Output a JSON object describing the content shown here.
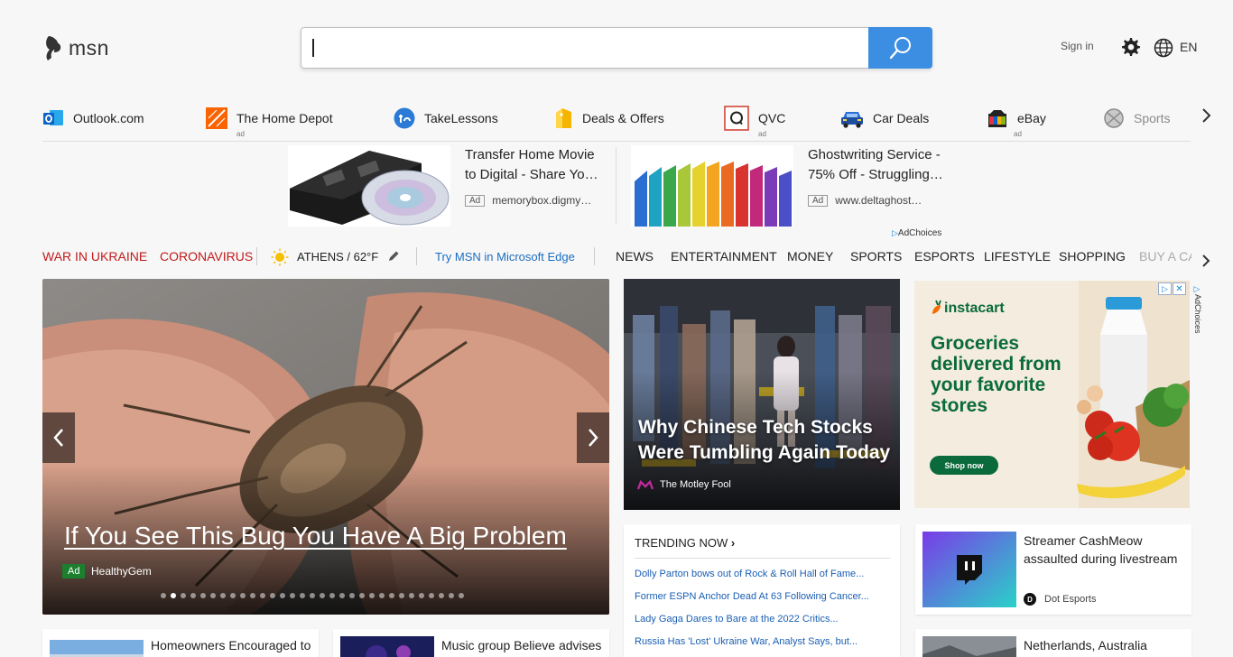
{
  "header": {
    "logo_text": "msn",
    "search": {
      "value": "",
      "placeholder": ""
    },
    "sign_in": "Sign in",
    "language": "EN"
  },
  "quick_links": [
    {
      "label": "Outlook.com",
      "ad": "",
      "icon": "outlook-icon",
      "color": "#0a64c8"
    },
    {
      "label": "The Home Depot",
      "ad": "ad",
      "icon": "home-depot-icon",
      "color": "#f96302"
    },
    {
      "label": "TakeLessons",
      "ad": "",
      "icon": "takelessons-icon",
      "color": "#2b7bd6"
    },
    {
      "label": "Deals & Offers",
      "ad": "",
      "icon": "deals-tag-icon",
      "color": "#f5b400"
    },
    {
      "label": "QVC",
      "ad": "ad",
      "icon": "qvc-icon",
      "color": "#d23b2b"
    },
    {
      "label": "Car Deals",
      "ad": "",
      "icon": "car-icon",
      "color": "#2b6fd6"
    },
    {
      "label": "eBay",
      "ad": "ad",
      "icon": "ebay-icon",
      "color": "#e53238"
    },
    {
      "label": "Sports",
      "ad": "",
      "icon": "sports-icon",
      "color": "#8a8a8a"
    }
  ],
  "top_ads": [
    {
      "title": "Transfer Home Movie to Digital - Share Yo…",
      "badge": "Ad",
      "source": "memorybox.digmy…"
    },
    {
      "title": "Ghostwriting Service - 75% Off - Struggling…",
      "badge": "Ad",
      "source": "www.deltaghost…"
    }
  ],
  "adchoices": "AdChoices",
  "nav": {
    "hot1": "WAR IN UKRAINE",
    "hot2": "CORONAVIRUS",
    "weather": "ATHENS / 62°F",
    "edge": "Try MSN in Microsoft Edge",
    "items": [
      "NEWS",
      "ENTERTAINMENT",
      "MONEY",
      "SPORTS",
      "ESPORTS",
      "LIFESTYLE",
      "SHOPPING",
      "BUY A CA"
    ]
  },
  "hero": {
    "title": "If You See This Bug You Have A Big Problem",
    "ad_badge": "Ad",
    "source": "HealthyGem",
    "slide_count": 31,
    "active_slide": 2
  },
  "mid_card": {
    "title": "Why Chinese Tech Stocks Were Tumbling Again Today",
    "source": "The Motley Fool"
  },
  "right_ad": {
    "brand": "instacart",
    "headline": "Groceries delivered from your favorite stores",
    "button": "Shop now",
    "adchoices": "AdChoices"
  },
  "trending": {
    "header": "TRENDING NOW",
    "items": [
      "Dolly Parton bows out of Rock & Roll Hall of Fame...",
      "Former ESPN Anchor Dead At 63 Following Cancer...",
      "Lady Gaga Dares to Bare at the 2022 Critics...",
      "Russia Has 'Lost' Ukraine War, Analyst Says, but..."
    ]
  },
  "side_card": {
    "title": "Streamer CashMeow assaulted during livestream",
    "source": "Dot Esports"
  },
  "bottom_cards": [
    {
      "title": "Homeowners Encouraged to"
    },
    {
      "title": "Music group Believe advises"
    },
    {
      "title": "Netherlands, Australia"
    }
  ]
}
